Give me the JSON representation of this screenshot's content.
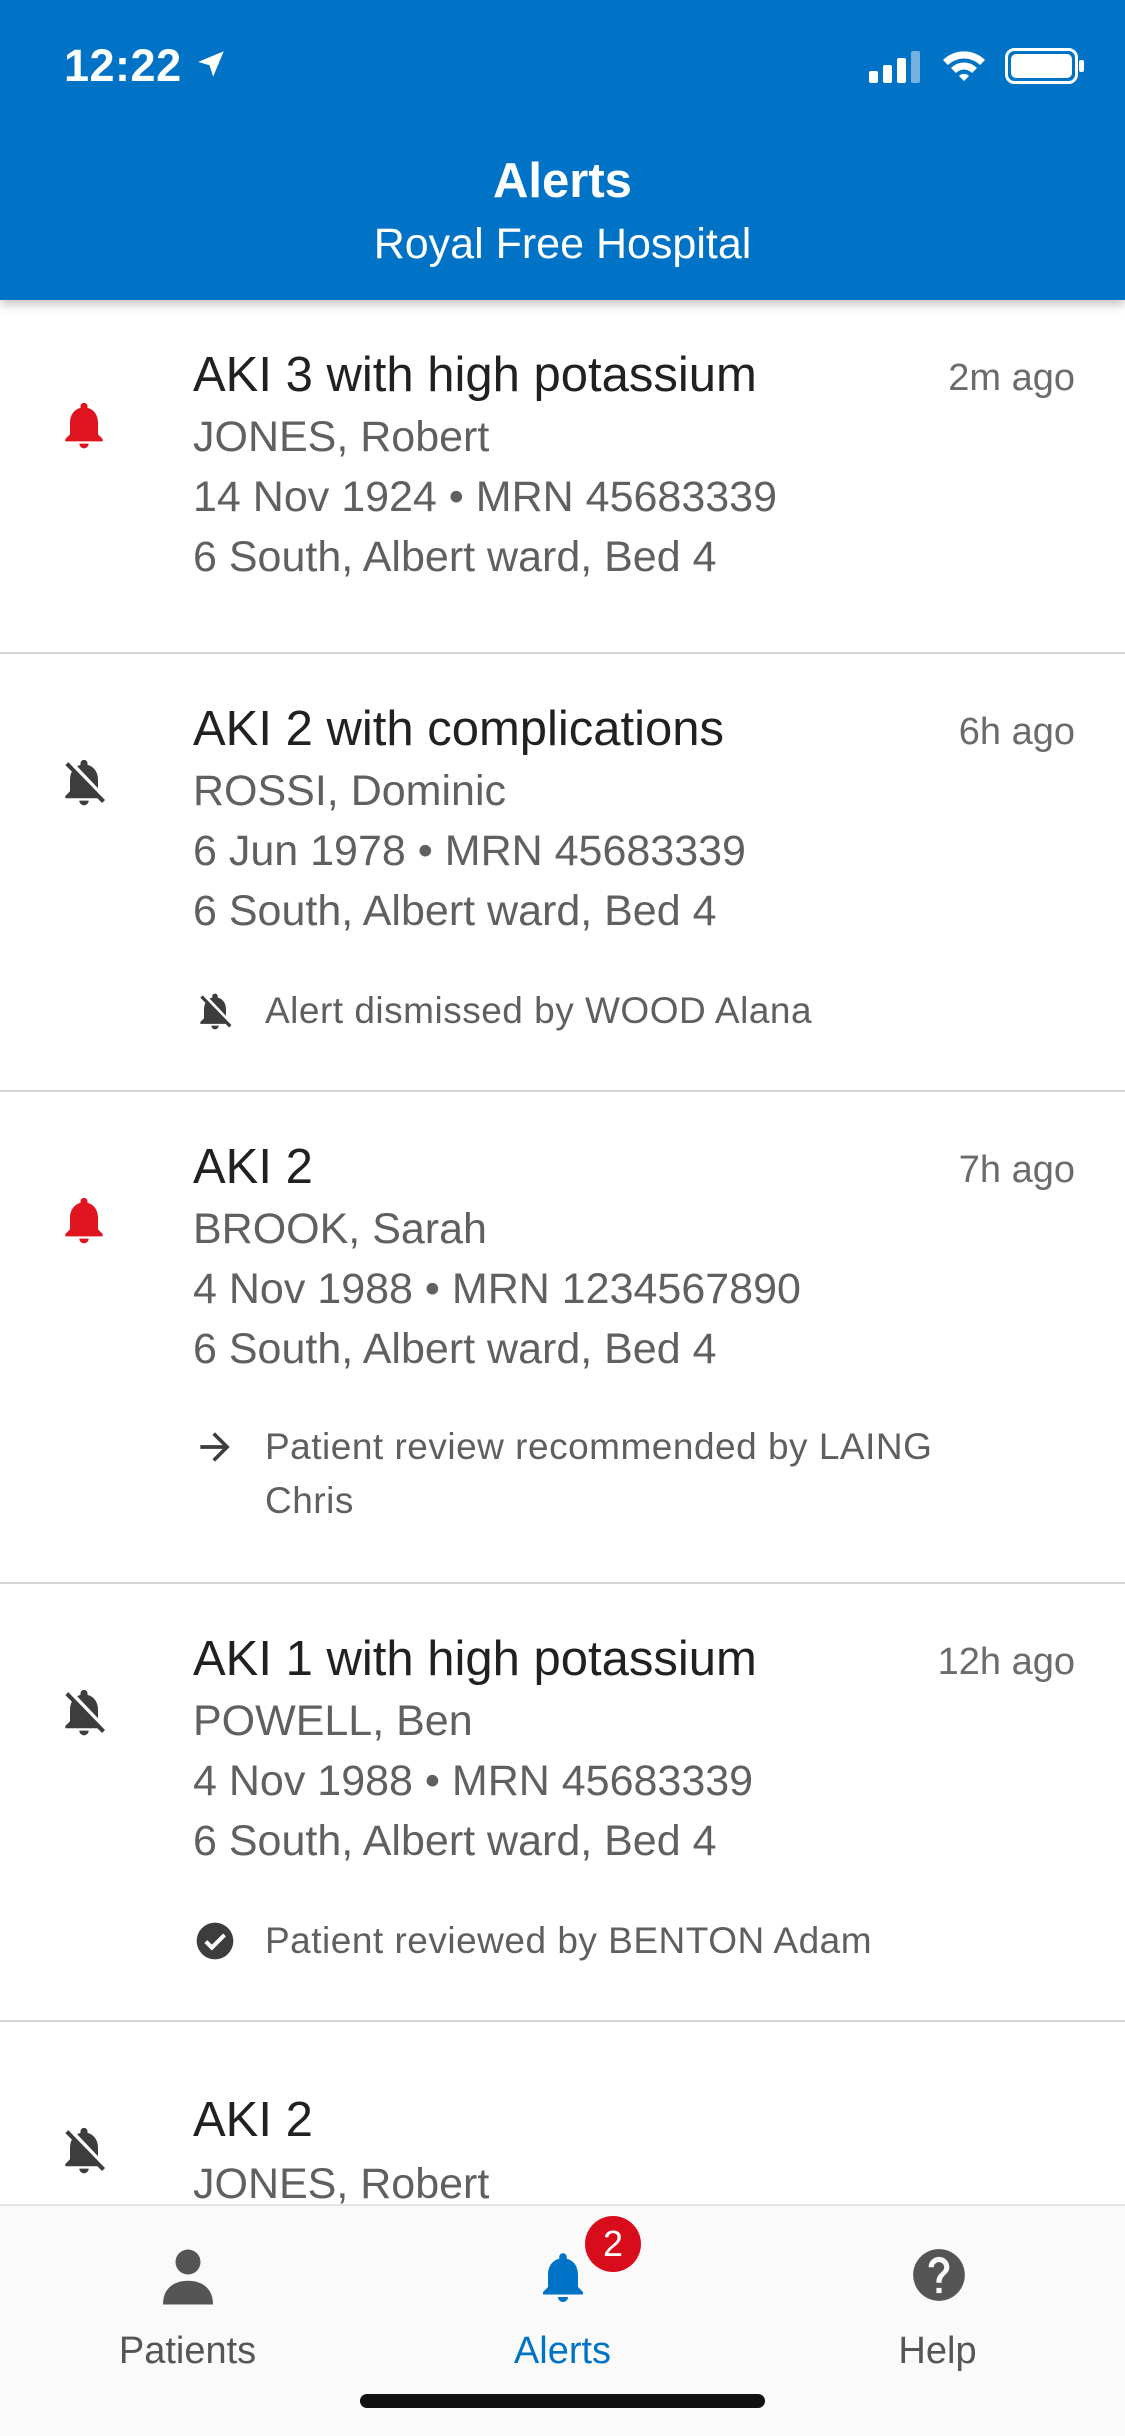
{
  "status_bar": {
    "time": "12:22"
  },
  "header": {
    "title": "Alerts",
    "subtitle": "Royal Free Hospital"
  },
  "alerts": [
    {
      "icon": "bell-active-icon",
      "title": "AKI 3 with high potassium",
      "time": "2m ago",
      "name": "JONES, Robert",
      "dob_mrn": "14 Nov 1924 • MRN 45683339",
      "location": "6 South, Albert ward, Bed 4"
    },
    {
      "icon": "bell-off-icon",
      "title": "AKI 2 with complications",
      "time": "6h ago",
      "name": "ROSSI, Dominic",
      "dob_mrn": "6 Jun 1978 • MRN 45683339",
      "location": "6 South, Albert ward, Bed 4",
      "note": "Alert dismissed by WOOD Alana",
      "note_icon": "bell-off-icon"
    },
    {
      "icon": "bell-active-icon",
      "title": "AKI 2",
      "time": "7h ago",
      "name": "BROOK, Sarah",
      "dob_mrn": "4 Nov 1988 • MRN 1234567890",
      "location": "6 South, Albert ward, Bed 4",
      "note": "Patient review recommended by LAING Chris",
      "note_icon": "arrow-right-icon"
    },
    {
      "icon": "bell-off-icon",
      "title": "AKI 1 with high potassium",
      "time": "12h ago",
      "name": "POWELL, Ben",
      "dob_mrn": "4 Nov 1988 • MRN 45683339",
      "location": "6 South, Albert ward, Bed 4",
      "note": "Patient reviewed by BENTON Adam",
      "note_icon": "check-circle-icon"
    },
    {
      "icon": "bell-off-icon",
      "title": "AKI 2",
      "name": "JONES, Robert"
    }
  ],
  "nav": {
    "tabs": [
      {
        "label": "Patients",
        "icon": "person-icon",
        "active": false
      },
      {
        "label": "Alerts",
        "icon": "bell-icon",
        "active": true,
        "badge": "2"
      },
      {
        "label": "Help",
        "icon": "help-circle-icon",
        "active": false
      }
    ]
  },
  "colors": {
    "header_bg": "#0073c6",
    "alert_active": "#e0141e",
    "icon_muted": "#3d3d3d",
    "nav_active": "#0073c6",
    "badge": "#d90c1b"
  }
}
